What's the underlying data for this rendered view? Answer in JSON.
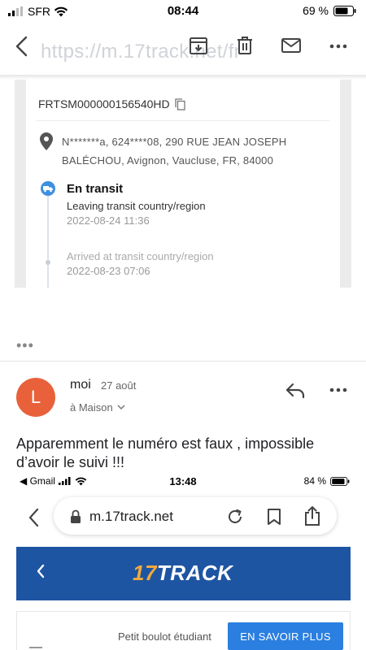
{
  "status_bar": {
    "carrier": "SFR",
    "time": "08:44",
    "battery": "69 %"
  },
  "appbar": {
    "ghost_url": "https://m.17track.net/fr",
    "icons": [
      "back-arrow-icon",
      "archive-icon",
      "trash-icon",
      "mail-icon",
      "more-vert-icon"
    ]
  },
  "tracking": {
    "tracking_number": "FRTSM000000156540HD",
    "address_line1": "N*******a,  624****08,  290 RUE JEAN JOSEPH",
    "address_line2": "BALÉCHOU,  Avignon,  Vaucluse,  FR,  84000",
    "events": [
      {
        "title": "En transit",
        "description": "Leaving transit country/region",
        "time": "2022-08-24 11:36"
      },
      {
        "description": "Arrived at transit country/region",
        "time": "2022-08-23 07:06"
      }
    ]
  },
  "message": {
    "avatar_letter": "L",
    "avatar_color": "#e8613a",
    "sender": "moi",
    "date": "27 août",
    "recipient": "à Maison",
    "body": "Apparemment le numéro est faux , impossible d’avoir le suivi !!!"
  },
  "embedded": {
    "status": {
      "back_app": "◀ Gmail",
      "time": "13:48",
      "battery": "84 %"
    },
    "url": "m.17track.net",
    "brand": {
      "num": "17",
      "text": "TRACK",
      "bar_color": "#1e55a3"
    },
    "ad": {
      "text": "Petit boulot étudiant",
      "button": "EN SAVOIR PLUS"
    }
  }
}
